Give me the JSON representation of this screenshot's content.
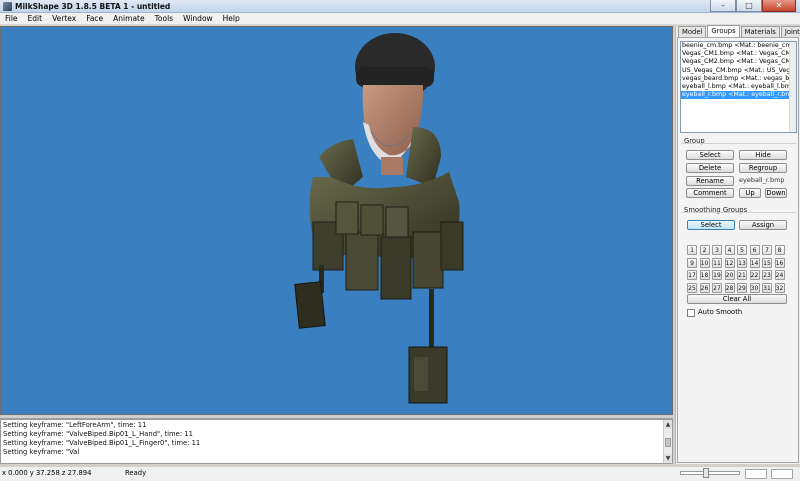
{
  "app": {
    "title": "MilkShape 3D 1.8.5 BETA 1 - untitled"
  },
  "window_controls": {
    "minimize": "–",
    "maximize": "□",
    "close": "✕"
  },
  "menu": [
    "File",
    "Edit",
    "Vertex",
    "Face",
    "Animate",
    "Tools",
    "Window",
    "Help"
  ],
  "tabs": [
    {
      "label": "Model",
      "active": false
    },
    {
      "label": "Groups",
      "active": true
    },
    {
      "label": "Materials",
      "active": false
    },
    {
      "label": "Joints",
      "active": false
    }
  ],
  "groups_list": [
    {
      "text": "beenie_cm.bmp <Mat.: beenie_cm.bmp>",
      "selected": false
    },
    {
      "text": "Vegas_CM1.bmp <Mat.: Vegas_CM1.bmp>",
      "selected": false
    },
    {
      "text": "Vegas_CM2.bmp <Mat.: Vegas_CM2.bmp>",
      "selected": false
    },
    {
      "text": "US_Vegas_CM.bmp <Mat.: US_Vegas_CM.bmp>",
      "selected": false
    },
    {
      "text": "vegas_beard.bmp <Mat.: vegas_beard.bmp>",
      "selected": false
    },
    {
      "text": "eyeball_l.bmp <Mat.: eyeball_l.bmp>",
      "selected": false
    },
    {
      "text": "eyeball_r.bmp <Mat.: eyeball_r.bmp>",
      "selected": true
    }
  ],
  "group_section": {
    "label": "Group",
    "select": "Select",
    "hide": "Hide",
    "delete": "Delete",
    "regroup": "Regroup",
    "rename": "Rename",
    "rename_value": "eyeball_r.bmp",
    "comment": "Comment",
    "up": "Up",
    "down": "Down"
  },
  "smoothing": {
    "label": "Smoothing Groups",
    "select": "Select",
    "assign": "Assign",
    "numbers": [
      "1",
      "2",
      "3",
      "4",
      "5",
      "6",
      "7",
      "8",
      "9",
      "10",
      "11",
      "12",
      "13",
      "14",
      "15",
      "16",
      "17",
      "18",
      "19",
      "20",
      "21",
      "22",
      "23",
      "24",
      "25",
      "26",
      "27",
      "28",
      "29",
      "30",
      "31",
      "32"
    ],
    "clear_all": "Clear All",
    "auto_smooth": "Auto Smooth"
  },
  "log": [
    "Setting keyframe: \"LeftForeArm\", time: 11",
    "Setting keyframe: \"ValveBiped.Bip01_L_Hand\", time: 11",
    "Setting keyframe: \"ValveBiped.Bip01_L_Finger0\", time: 11",
    "Setting keyframe: \"Val"
  ],
  "status": {
    "coords": "x 0.000 y 37.258 z 27.894",
    "state": "Ready"
  },
  "colors": {
    "viewport_bg": "#3a7fbf",
    "selection": "#3399ff"
  }
}
